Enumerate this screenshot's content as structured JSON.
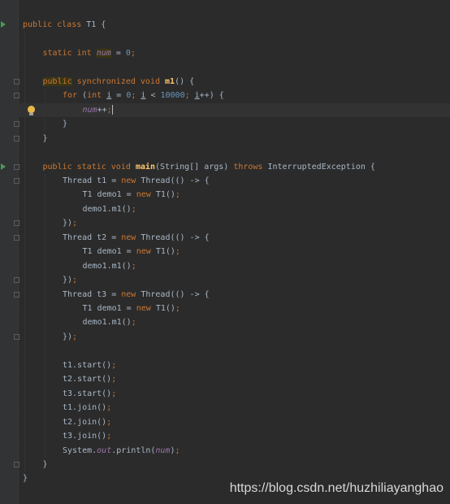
{
  "editor": {
    "colors": {
      "background": "#2b2b2b",
      "keyword": "#cc7832",
      "field": "#9876aa",
      "method": "#ffc66d",
      "number": "#6897bb",
      "plain": "#a9b7c6"
    },
    "lines": [
      {
        "row": 1,
        "indent": 0,
        "tokens": [
          [
            "kw",
            "public class "
          ],
          [
            "p",
            "T1 {"
          ]
        ]
      },
      {
        "row": 3,
        "indent": 1,
        "tokens": [
          [
            "kw",
            "static int "
          ],
          [
            "fldh",
            "num"
          ],
          [
            "p",
            " = "
          ],
          [
            "num",
            "0"
          ],
          [
            "kw",
            ";"
          ]
        ]
      },
      {
        "row": 5,
        "indent": 1,
        "tokens": [
          [
            "kwh",
            "public"
          ],
          [
            "kw",
            " synchronized void "
          ],
          [
            "mth",
            "m1"
          ],
          [
            "p",
            "() {"
          ]
        ]
      },
      {
        "row": 6,
        "indent": 2,
        "tokens": [
          [
            "kw",
            "for "
          ],
          [
            "p",
            "("
          ],
          [
            "kw",
            "int "
          ],
          [
            "pu",
            "i"
          ],
          [
            "p",
            " = "
          ],
          [
            "num",
            "0"
          ],
          [
            "kw",
            "; "
          ],
          [
            "pu",
            "i"
          ],
          [
            "p",
            " < "
          ],
          [
            "num",
            "10000"
          ],
          [
            "kw",
            "; "
          ],
          [
            "pu",
            "i"
          ],
          [
            "p",
            "++) {"
          ]
        ]
      },
      {
        "row": 7,
        "indent": 3,
        "tokens": [
          [
            "fld",
            "num"
          ],
          [
            "p",
            "++"
          ],
          [
            "kw",
            ";"
          ]
        ]
      },
      {
        "row": 8,
        "indent": 2,
        "tokens": [
          [
            "p",
            "}"
          ]
        ]
      },
      {
        "row": 9,
        "indent": 1,
        "tokens": [
          [
            "p",
            "}"
          ]
        ]
      },
      {
        "row": 11,
        "indent": 1,
        "tokens": [
          [
            "kw",
            "public static void "
          ],
          [
            "mth",
            "main"
          ],
          [
            "p",
            "(String[] args) "
          ],
          [
            "kw",
            "throws "
          ],
          [
            "p",
            "InterruptedException {"
          ]
        ]
      },
      {
        "row": 12,
        "indent": 2,
        "tokens": [
          [
            "p",
            "Thread t1 = "
          ],
          [
            "kw",
            "new "
          ],
          [
            "p",
            "Thread(() -> {"
          ]
        ]
      },
      {
        "row": 13,
        "indent": 3,
        "tokens": [
          [
            "p",
            "T1 demo1 = "
          ],
          [
            "kw",
            "new "
          ],
          [
            "p",
            "T1()"
          ],
          [
            "kw",
            ";"
          ]
        ]
      },
      {
        "row": 14,
        "indent": 3,
        "tokens": [
          [
            "p",
            "demo1.m1()"
          ],
          [
            "kw",
            ";"
          ]
        ]
      },
      {
        "row": 15,
        "indent": 2,
        "tokens": [
          [
            "p",
            "})"
          ],
          [
            "kw",
            ";"
          ]
        ]
      },
      {
        "row": 16,
        "indent": 2,
        "tokens": [
          [
            "p",
            "Thread t2 = "
          ],
          [
            "kw",
            "new "
          ],
          [
            "p",
            "Thread(() -> {"
          ]
        ]
      },
      {
        "row": 17,
        "indent": 3,
        "tokens": [
          [
            "p",
            "T1 demo1 = "
          ],
          [
            "kw",
            "new "
          ],
          [
            "p",
            "T1()"
          ],
          [
            "kw",
            ";"
          ]
        ]
      },
      {
        "row": 18,
        "indent": 3,
        "tokens": [
          [
            "p",
            "demo1.m1()"
          ],
          [
            "kw",
            ";"
          ]
        ]
      },
      {
        "row": 19,
        "indent": 2,
        "tokens": [
          [
            "p",
            "})"
          ],
          [
            "kw",
            ";"
          ]
        ]
      },
      {
        "row": 20,
        "indent": 2,
        "tokens": [
          [
            "p",
            "Thread t3 = "
          ],
          [
            "kw",
            "new "
          ],
          [
            "p",
            "Thread(() -> {"
          ]
        ]
      },
      {
        "row": 21,
        "indent": 3,
        "tokens": [
          [
            "p",
            "T1 demo1 = "
          ],
          [
            "kw",
            "new "
          ],
          [
            "p",
            "T1()"
          ],
          [
            "kw",
            ";"
          ]
        ]
      },
      {
        "row": 22,
        "indent": 3,
        "tokens": [
          [
            "p",
            "demo1.m1()"
          ],
          [
            "kw",
            ";"
          ]
        ]
      },
      {
        "row": 23,
        "indent": 2,
        "tokens": [
          [
            "p",
            "})"
          ],
          [
            "kw",
            ";"
          ]
        ]
      },
      {
        "row": 25,
        "indent": 2,
        "tokens": [
          [
            "p",
            "t1.start()"
          ],
          [
            "kw",
            ";"
          ]
        ]
      },
      {
        "row": 26,
        "indent": 2,
        "tokens": [
          [
            "p",
            "t2.start()"
          ],
          [
            "kw",
            ";"
          ]
        ]
      },
      {
        "row": 27,
        "indent": 2,
        "tokens": [
          [
            "p",
            "t3.start()"
          ],
          [
            "kw",
            ";"
          ]
        ]
      },
      {
        "row": 28,
        "indent": 2,
        "tokens": [
          [
            "p",
            "t1.join()"
          ],
          [
            "kw",
            ";"
          ]
        ]
      },
      {
        "row": 29,
        "indent": 2,
        "tokens": [
          [
            "p",
            "t2.join()"
          ],
          [
            "kw",
            ";"
          ]
        ]
      },
      {
        "row": 30,
        "indent": 2,
        "tokens": [
          [
            "p",
            "t3.join()"
          ],
          [
            "kw",
            ";"
          ]
        ]
      },
      {
        "row": 31,
        "indent": 2,
        "tokens": [
          [
            "p",
            "System."
          ],
          [
            "fld",
            "out"
          ],
          [
            "p",
            ".println("
          ],
          [
            "fld",
            "num"
          ],
          [
            "p",
            ")"
          ],
          [
            "kw",
            ";"
          ]
        ]
      },
      {
        "row": 32,
        "indent": 1,
        "tokens": [
          [
            "p",
            "}"
          ]
        ]
      },
      {
        "row": 33,
        "indent": 0,
        "tokens": [
          [
            "p",
            "}"
          ]
        ]
      }
    ],
    "current_row": 7,
    "gutter": {
      "run_rows": [
        1,
        11
      ],
      "fold_rows": [
        5,
        6,
        8,
        9,
        11,
        12,
        15,
        16,
        19,
        20,
        23,
        32
      ],
      "bulb_row": 7,
      "run_icon": "run-arrow-icon",
      "fold_icon": "fold-marker-icon",
      "bulb_icon": "lightbulb-icon"
    }
  },
  "watermark": "https://blog.csdn.net/huzhiliayanghao"
}
